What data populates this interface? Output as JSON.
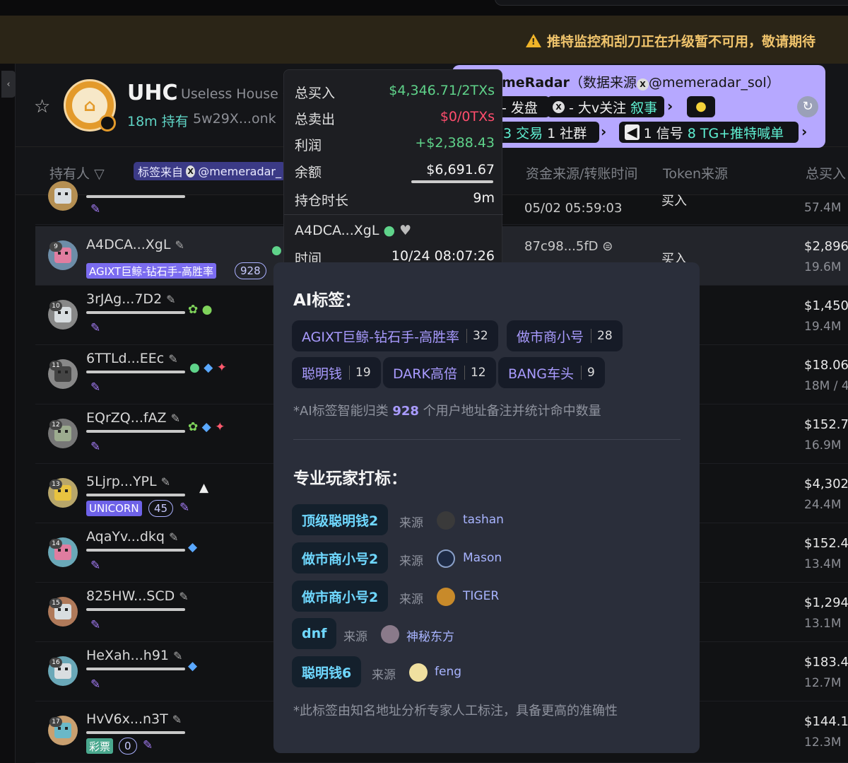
{
  "banner": {
    "notice": "推特监控和刮刀正在升级暂不可用，敬请期待"
  },
  "token": {
    "symbol": "UHC",
    "name": "Useless House C",
    "age": "18m",
    "age_suffix": "持有",
    "address": "5w29X...onk"
  },
  "columns": {
    "holder": "持有人",
    "tag_source": "标签来自",
    "tag_handle": "@memeradar_",
    "fund_source": "资金来源/转账时间",
    "token_source": "Token来源",
    "total_buy": "总买入"
  },
  "radar": {
    "title_bold": "meRadar",
    "title_rest": "（数据来源",
    "handle": "@memeradar_sol）",
    "line2a": "- 发盘",
    "line2b": "- 大v关注",
    "line2c": "叙事",
    "line3a": "3 交易",
    "line3b": "1 社群",
    "line3c": "1 信号",
    "line3d": "8 TG+推特喊单"
  },
  "summary": {
    "total_buy_label": "总买入",
    "total_buy_value": "$4,346.71/2TXs",
    "total_sell_label": "总卖出",
    "total_sell_value": "$0/0TXs",
    "profit_label": "利润",
    "profit_value": "+$2,388.43",
    "balance_label": "余额",
    "balance_value": "$6,691.67",
    "hold_label": "持仓时长",
    "hold_value": "9m",
    "wallet": "A4DCA...XgL",
    "time_label": "时间",
    "time_value": "10/24 08:07:26"
  },
  "ai": {
    "title": "AI标签：",
    "chips": [
      {
        "label": "AGIXT巨鲸-钻石手-高胜率",
        "count": "32"
      },
      {
        "label": "做市商小号",
        "count": "28"
      },
      {
        "label": "聪明钱",
        "count": "19"
      },
      {
        "label": "DARK高倍",
        "count": "12"
      },
      {
        "label": "BANG车头",
        "count": "9"
      }
    ],
    "note_pre": "*AI标签智能归类",
    "note_num": "928",
    "note_post": "个用户地址备注并统计命中数量",
    "pro_title": "专业玩家打标：",
    "from_label": "来源",
    "pro": [
      {
        "label": "顶级聪明钱2",
        "source": "tashan"
      },
      {
        "label": "做市商小号2",
        "source": "Mason"
      },
      {
        "label": "做市商小号2",
        "source": "TIGER"
      },
      {
        "label": "dnf",
        "source": "神秘东方"
      },
      {
        "label": "聪明钱6",
        "source": "feng"
      }
    ],
    "pro_note": "*此标签由知名地址分析专家人工标注，具备更高的准确性"
  },
  "rows": [
    {
      "rank": "",
      "address": "",
      "src": "05/02 05:59:03",
      "token_src": "买入",
      "amount": "",
      "sub": "57.4M"
    },
    {
      "rank": "9",
      "address": "A4DCA...XgL",
      "label": "AGIXT巨鲸-钻石手-高胜率",
      "count": "928",
      "src": "87c98...5fD",
      "token_src": "买入",
      "amount": "$2,896",
      "sub": "19.6M"
    },
    {
      "rank": "10",
      "address": "3rJAg...7D2",
      "amount": "$1,450",
      "sub": "19.4M"
    },
    {
      "rank": "11",
      "address": "6TTLd...EEc",
      "amount": "$18.06",
      "sub": "18M / 4"
    },
    {
      "rank": "12",
      "address": "EQrZQ...fAZ",
      "amount": "$152.7",
      "sub": "16.9M"
    },
    {
      "rank": "13",
      "address": "5Ljrp...YPL",
      "label": "UNICORN",
      "count": "45",
      "amount": "$4,302",
      "sub": "24.4M"
    },
    {
      "rank": "14",
      "address": "AqaYv...dkq",
      "amount": "$152.4",
      "sub": "13.4M"
    },
    {
      "rank": "15",
      "address": "825HW...SCD",
      "amount": "$1,294",
      "sub": "13.1M"
    },
    {
      "rank": "16",
      "address": "HeXah...h91",
      "amount": "$183.4",
      "sub": "12.7M"
    },
    {
      "rank": "17",
      "address": "HvV6x...n3T",
      "label": "彩票",
      "count": "0",
      "amount": "$144.1",
      "sub": "12.3M"
    }
  ],
  "colors": {
    "accent": "#b6a8ff",
    "positive": "#5fd38a",
    "negative": "#ff4d6d",
    "chip_text": "#a99bff"
  }
}
